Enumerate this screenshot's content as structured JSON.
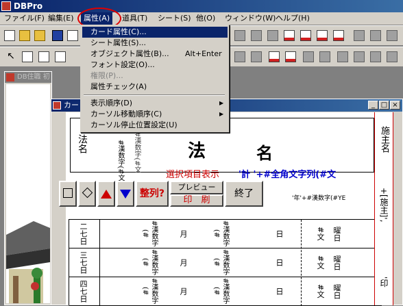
{
  "app": {
    "title": "DBPro"
  },
  "menubar": {
    "items": [
      {
        "label": "ファイル(F)"
      },
      {
        "label": "編集(E)"
      },
      {
        "label": "属性(A)"
      },
      {
        "label": "道具(T)"
      },
      {
        "label": "シート(S)"
      },
      {
        "label": "他(O)"
      },
      {
        "label": "ウィンドウ(W)"
      },
      {
        "label": "ヘルプ(H)"
      }
    ]
  },
  "dropdown": {
    "items": [
      {
        "label": "カード属性(C)...",
        "shortcut": "",
        "highlighted": true
      },
      {
        "label": "シート属性(S)...",
        "shortcut": ""
      },
      {
        "label": "オブジェクト属性(B)...",
        "shortcut": "Alt+Enter"
      },
      {
        "label": "フォント設定(O)...",
        "shortcut": ""
      },
      {
        "label": "権限(P)...",
        "shortcut": "",
        "disabled": true
      },
      {
        "label": "属性チェック(A)",
        "shortcut": ""
      },
      {
        "label": "表示順序(D)",
        "shortcut": "",
        "submenu": true
      },
      {
        "label": "カーソル移動順序(C)",
        "shortcut": "",
        "submenu": true
      },
      {
        "label": "カーソル停止位置設定(U)",
        "shortcut": ""
      }
    ]
  },
  "left_window": {
    "title": "DB住職 初"
  },
  "card_window": {
    "title": "カー"
  },
  "card": {
    "name_label": "法名",
    "name_big": "法",
    "name_big2": "名",
    "sample_code": "#漢数字(#文",
    "sample_code2": "#漢数字(#文",
    "select_display": "選択項目表示",
    "formula": "'計 '+#全角文字列(#文",
    "sort_btn": "整列?",
    "preview_btn": "プレビュー",
    "print_btn": "印　刷",
    "end_btn": "終了",
    "right_header": "施主名",
    "right_text": "+[施主]',",
    "right_text2": "'印",
    "year_text": "'年'+#漢数字(#YE"
  },
  "table": {
    "rows": [
      {
        "day": "二七日",
        "num": "#漢数字(#",
        "m": "月",
        "num2": "#漢数字(#",
        "d": "日",
        "w": "#文",
        "wd": "曜日"
      },
      {
        "day": "三七日",
        "num": "#漢数字(#",
        "m": "月",
        "num2": "#漢数字(#",
        "d": "日",
        "w": "#文",
        "wd": "曜日"
      },
      {
        "day": "四七日",
        "num": "#漢数字(#",
        "m": "月",
        "num2": "#漢数字(#",
        "d": "日",
        "w": "#文",
        "wd": "曜日"
      }
    ]
  },
  "colors": {
    "accent": "#0a246a",
    "red": "#cc0000",
    "blue": "#0000cc"
  }
}
